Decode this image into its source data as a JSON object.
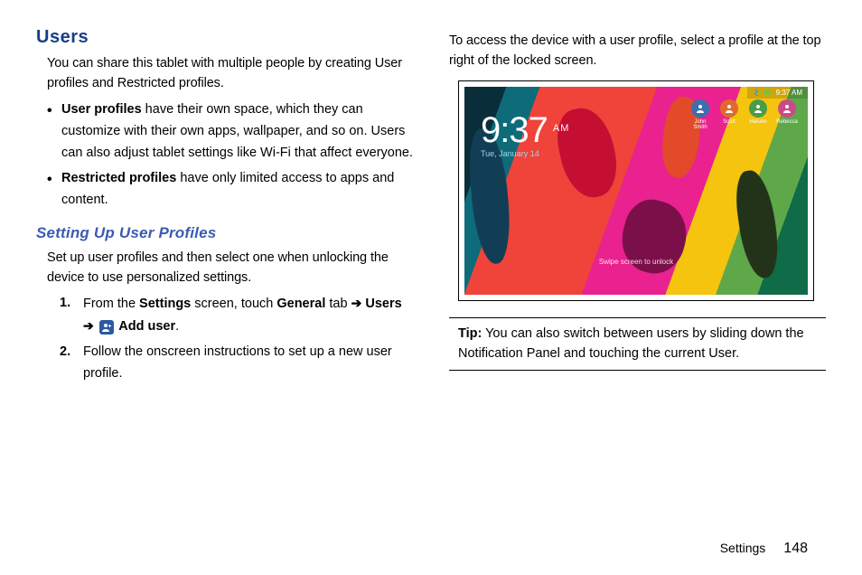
{
  "left": {
    "heading": "Users",
    "intro": "You can share this tablet with multiple people by creating User profiles and Restricted profiles.",
    "bullets": [
      {
        "label": "User profiles",
        "text": " have their own space, which they can customize with their own apps, wallpaper, and so on. Users can also adjust tablet settings like Wi-Fi that affect everyone."
      },
      {
        "label": "Restricted profiles",
        "text": " have only limited access to apps and content."
      }
    ],
    "subheading": "Setting Up User Profiles",
    "sub_intro": "Set up user profiles and then select one when unlocking the device to use personalized settings.",
    "step1_pre": "From the ",
    "step1_settings": "Settings",
    "step1_mid": " screen, touch ",
    "step1_general": "General",
    "step1_tab": " tab ",
    "step1_arrow1": "➔",
    "step1_users": " Users",
    "step1_arrow2": "➔",
    "step1_adduser": " Add user",
    "step1_end": ".",
    "step2": "Follow the onscreen instructions to set up a new user profile."
  },
  "right": {
    "intro": "To access the device with a user profile, select a profile at the top right of the locked screen.",
    "lockscreen": {
      "status_time": "9:37 AM",
      "time": "9:37",
      "ampm": "AM",
      "date": "Tue, January 14",
      "swipe": "Swipe screen to unlock",
      "profiles": [
        "John\nSmith",
        "Scott",
        "Haruko",
        "Rebecca"
      ]
    },
    "tip_label": "Tip:",
    "tip_text": " You can also switch between users by sliding down the Notification Panel and touching the current User."
  },
  "footer": {
    "section": "Settings",
    "page": "148"
  }
}
